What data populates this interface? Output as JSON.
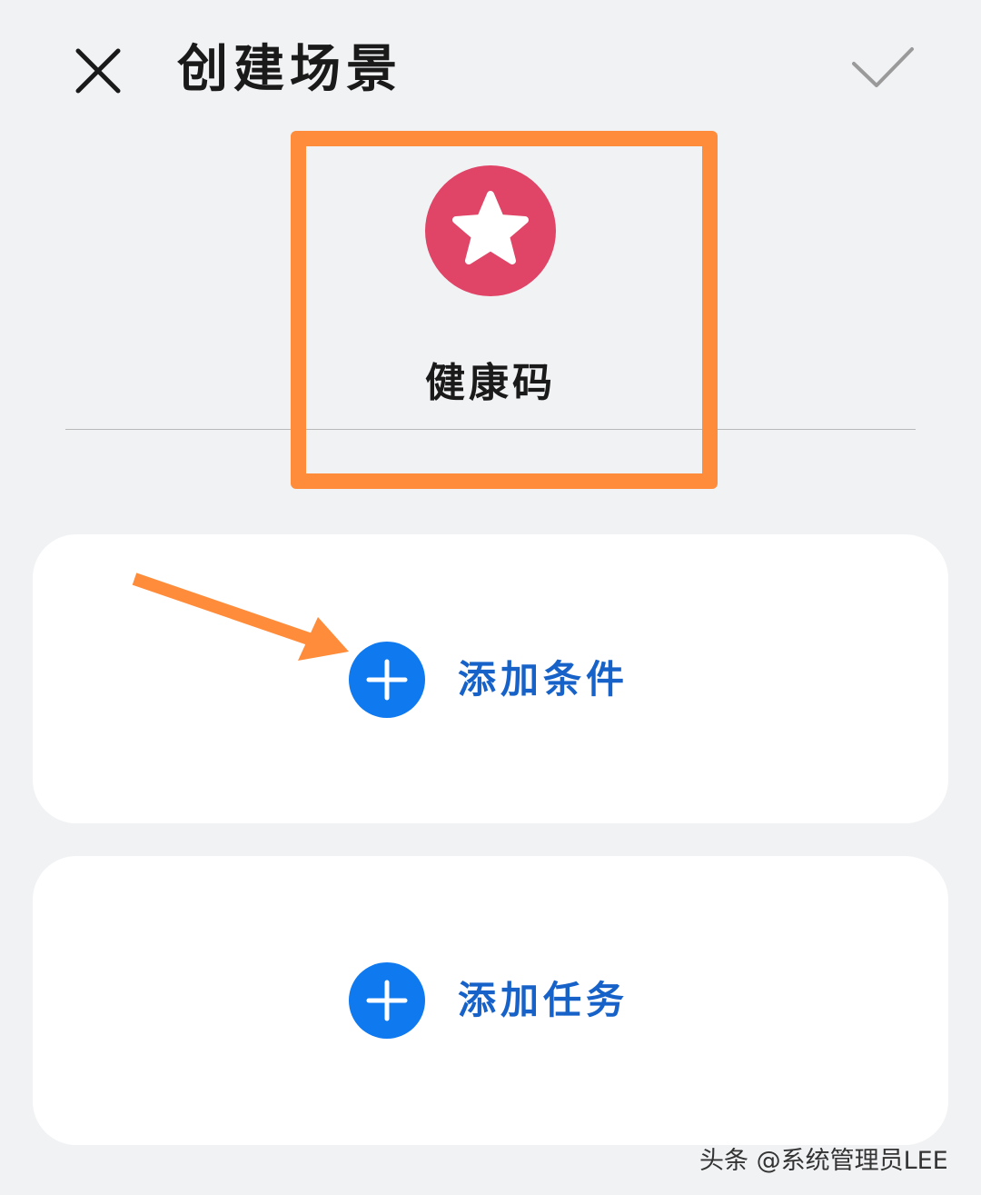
{
  "header": {
    "title": "创建场景",
    "close_icon": "close-icon",
    "confirm_icon": "check-icon"
  },
  "scene": {
    "icon": "star-icon",
    "icon_color": "#e04466",
    "name": "健康码"
  },
  "condition_card": {
    "icon": "plus-icon",
    "label": "添加条件"
  },
  "task_card": {
    "icon": "plus-icon",
    "label": "添加任务"
  },
  "annotation": {
    "highlight_color": "#ff8c3a",
    "arrow_color": "#ff8c3a"
  },
  "accent_color": "#0f79f0",
  "watermark": "头条 @系统管理员LEE"
}
